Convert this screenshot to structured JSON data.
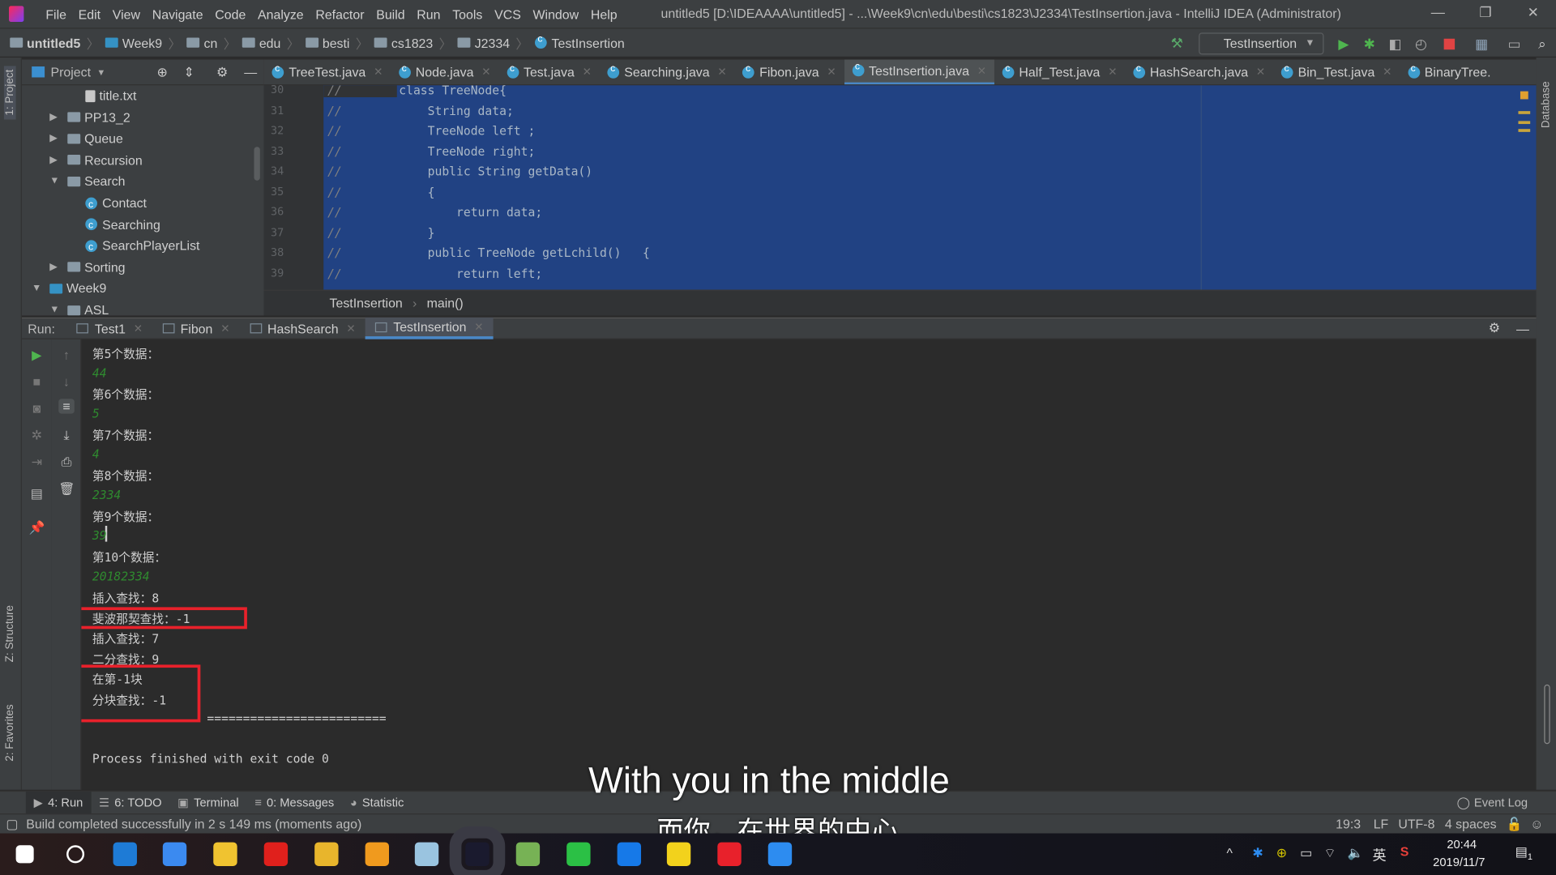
{
  "window": {
    "title": "untitled5 [D:\\IDEAAAA\\untitled5] - ...\\Week9\\cn\\edu\\besti\\cs1823\\J2334\\TestInsertion.java - IntelliJ IDEA (Administrator)",
    "menu": [
      "File",
      "Edit",
      "View",
      "Navigate",
      "Code",
      "Analyze",
      "Refactor",
      "Build",
      "Run",
      "Tools",
      "VCS",
      "Window",
      "Help"
    ]
  },
  "breadcrumb": [
    "untitled5",
    "Week9",
    "cn",
    "edu",
    "besti",
    "cs1823",
    "J2334",
    "TestInsertion"
  ],
  "toolbar": {
    "run_config": "TestInsertion"
  },
  "sidebar": {
    "left_labels": [
      "1: Project",
      "Z: Structure",
      "2: Favorites"
    ],
    "right_label": "Database"
  },
  "project": {
    "header": "Project",
    "items": [
      {
        "label": "title.txt",
        "type": "file",
        "depth": 3
      },
      {
        "label": "PP13_2",
        "type": "folder",
        "depth": 2,
        "expanded": false
      },
      {
        "label": "Queue",
        "type": "folder",
        "depth": 2,
        "expanded": false
      },
      {
        "label": "Recursion",
        "type": "folder",
        "depth": 2,
        "expanded": false
      },
      {
        "label": "Search",
        "type": "folder",
        "depth": 2,
        "expanded": true
      },
      {
        "label": "Contact",
        "type": "class",
        "depth": 3
      },
      {
        "label": "Searching",
        "type": "class",
        "depth": 3
      },
      {
        "label": "SearchPlayerList",
        "type": "class",
        "depth": 3
      },
      {
        "label": "Sorting",
        "type": "folder",
        "depth": 2,
        "expanded": false
      },
      {
        "label": "Week9",
        "type": "module",
        "depth": 1,
        "expanded": true
      },
      {
        "label": "ASL",
        "type": "folder",
        "depth": 2,
        "expanded": true
      }
    ]
  },
  "editor": {
    "tabs": [
      {
        "label": "TreeTest.java"
      },
      {
        "label": "Node.java"
      },
      {
        "label": "Test.java"
      },
      {
        "label": "Searching.java"
      },
      {
        "label": "Fibon.java"
      },
      {
        "label": "TestInsertion.java",
        "active": true
      },
      {
        "label": "Half_Test.java"
      },
      {
        "label": "HashSearch.java"
      },
      {
        "label": "Bin_Test.java"
      },
      {
        "label": "BinaryTree."
      }
    ],
    "lines": [
      {
        "n": "30",
        "code": "class TreeNode{"
      },
      {
        "n": "31",
        "code": "    String data;"
      },
      {
        "n": "32",
        "code": "    TreeNode left ;"
      },
      {
        "n": "33",
        "code": "    TreeNode right;"
      },
      {
        "n": "34",
        "code": "    public String getData()"
      },
      {
        "n": "35",
        "code": "    {"
      },
      {
        "n": "36",
        "code": "        return data;"
      },
      {
        "n": "37",
        "code": "    }"
      },
      {
        "n": "38",
        "code": "    public TreeNode getLchild()   {"
      },
      {
        "n": "39",
        "code": "        return left;"
      }
    ],
    "comment": "//",
    "crumbs": [
      "TestInsertion",
      "main()"
    ]
  },
  "run": {
    "label": "Run:",
    "tabs": [
      {
        "label": "Test1"
      },
      {
        "label": "Fibon"
      },
      {
        "label": "HashSearch"
      },
      {
        "label": "TestInsertion",
        "active": true
      }
    ],
    "output": [
      {
        "t": "第5个数据："
      },
      {
        "t": "44",
        "input": true
      },
      {
        "t": "第6个数据："
      },
      {
        "t": "5",
        "input": true
      },
      {
        "t": "第7个数据："
      },
      {
        "t": "4",
        "input": true
      },
      {
        "t": "第8个数据："
      },
      {
        "t": "2334",
        "input": true
      },
      {
        "t": "第9个数据："
      },
      {
        "t": "39",
        "input": true
      },
      {
        "t": "第10个数据："
      },
      {
        "t": "20182334",
        "input": true
      },
      {
        "t": "插入查找：8"
      },
      {
        "t": "斐波那契查找：-1"
      },
      {
        "t": "插入查找：7"
      },
      {
        "t": "二分查找：9"
      },
      {
        "t": "在第-1块"
      },
      {
        "t": "分块查找：-1"
      },
      {
        "t": "                ========================="
      },
      {
        "t": ""
      },
      {
        "t": "Process finished with exit code 0"
      }
    ]
  },
  "bottom_tabs": [
    "4: Run",
    "6: TODO",
    "Terminal",
    "0: Messages",
    "Statistic"
  ],
  "event_log": "Event Log",
  "status": {
    "message": "Build completed successfully in 2 s 149 ms (moments ago)",
    "position": "19:3",
    "line_sep": "LF",
    "encoding": "UTF-8",
    "indent": "4 spaces"
  },
  "subtitles": {
    "en": "With you in the middle",
    "zh": "而你，在世界的中心"
  },
  "taskbar": {
    "time": "20:44",
    "date": "2019/11/7",
    "ime": "英",
    "notifications": "1",
    "apps": [
      "start",
      "cortana",
      "edge",
      "notes",
      "explorer",
      "youdao",
      "chrome",
      "app-orange",
      "paint",
      "intellij",
      "android-studio",
      "wechat",
      "app-star",
      "qq-music",
      "netease-music",
      "phone"
    ]
  },
  "colors": {
    "selection": "#214283",
    "highlight_box": "#e8212b",
    "input_text": "#2f8a2f",
    "accent": "#4a88c7"
  }
}
